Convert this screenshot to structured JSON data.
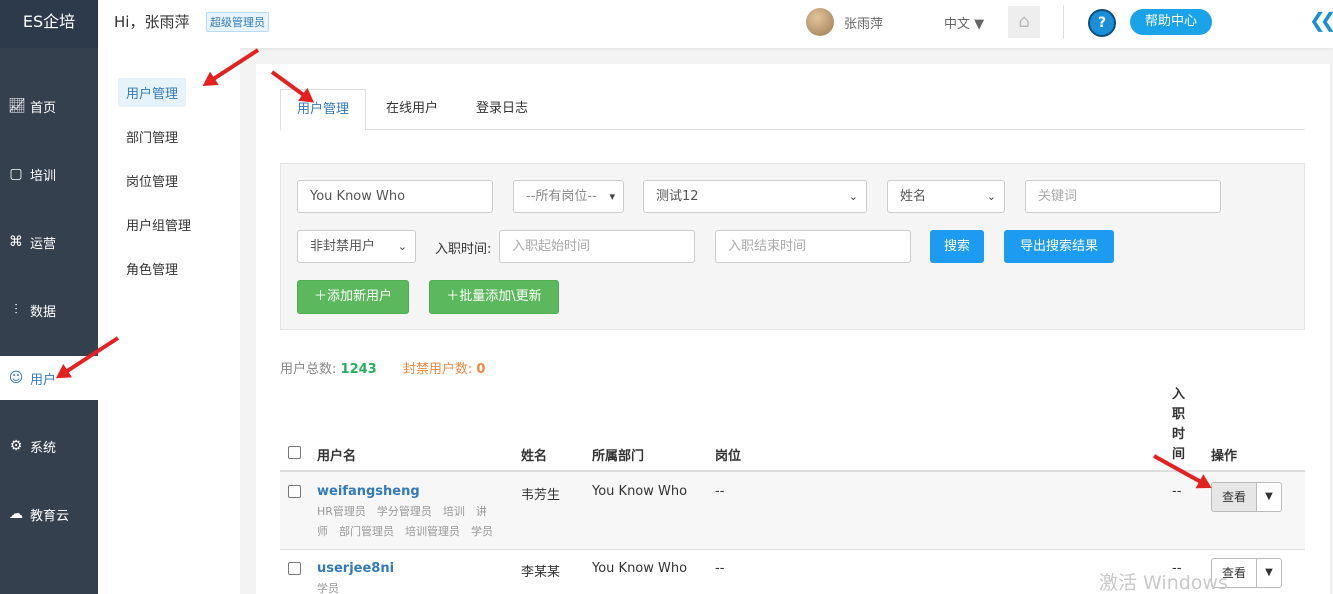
{
  "app": {
    "logo": "ES企培"
  },
  "sidebar": {
    "items": [
      {
        "label": "首页",
        "icon": "chart-icon"
      },
      {
        "label": "培训",
        "icon": "book-icon"
      },
      {
        "label": "运营",
        "icon": "command-icon"
      },
      {
        "label": "数据",
        "icon": "bar-chart-icon"
      },
      {
        "label": "用户",
        "icon": "users-icon",
        "active": true
      },
      {
        "label": "系统",
        "icon": "gear-icon"
      },
      {
        "label": "教育云",
        "icon": "cloud-icon"
      }
    ]
  },
  "topbar": {
    "greeting": "Hi，张雨萍",
    "role_badge": "超级管理员",
    "username": "张雨萍",
    "language": "中文",
    "help_label": "帮助中心",
    "help_symbol": "?"
  },
  "subnav": {
    "items": [
      {
        "label": "用户管理",
        "active": true
      },
      {
        "label": "部门管理"
      },
      {
        "label": "岗位管理"
      },
      {
        "label": "用户组管理"
      },
      {
        "label": "角色管理"
      }
    ]
  },
  "tabs": [
    {
      "label": "用户管理",
      "active": true
    },
    {
      "label": "在线用户"
    },
    {
      "label": "登录日志"
    }
  ],
  "filters": {
    "org_value": "You Know Who",
    "post_value": "--所有岗位--",
    "dept_value": "测试12",
    "keyword_type": "姓名",
    "keyword_placeholder": "关键词",
    "lock_status": "非封禁用户",
    "hire_time_label": "入职时间:",
    "hire_start_placeholder": "入职起始时间",
    "hire_end_placeholder": "入职结束时间",
    "search_label": "搜索",
    "export_label": "导出搜索结果",
    "add_user_label": "＋添加新用户",
    "batch_add_label": "＋批量添加\\更新"
  },
  "stats": {
    "total_label": "用户总数:",
    "total_value": "1243",
    "banned_label": "封禁用户数:",
    "banned_value": "0"
  },
  "table": {
    "headers": {
      "username": "用户名",
      "name": "姓名",
      "dept": "所属部门",
      "post": "岗位",
      "hire_time": "入职时间",
      "actions": "操作"
    },
    "rows": [
      {
        "username": "weifangsheng",
        "roles_line1": "HR管理员　学分管理员　培训　讲",
        "roles_line2": "师　部门管理员　培训管理员　学员",
        "name": "韦芳生",
        "dept": "You Know Who",
        "post": "--",
        "hire_time": "--",
        "view_label": "查看"
      },
      {
        "username": "userjee8ni",
        "roles_line1": "学员",
        "roles_line2": "",
        "name": "李某某",
        "dept": "You Know Who",
        "post": "--",
        "hire_time": "--",
        "view_label": "查看"
      }
    ]
  },
  "watermark": "激活 Windows",
  "colors": {
    "sidebar_bg": "#35404f",
    "accent_blue": "#337ab7",
    "button_blue": "#1c9bf0",
    "button_green": "#5cb85c",
    "stat_green": "#27ae60",
    "stat_orange": "#f0883e",
    "annotation_red": "#e52020"
  }
}
